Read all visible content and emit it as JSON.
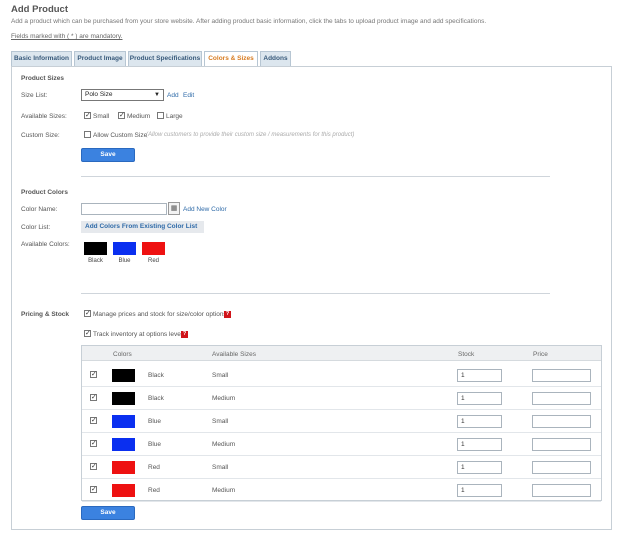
{
  "page": {
    "title": "Add Product",
    "intro": "Add a product which can be purchased from your store website. After adding product basic information, click the tabs to upload product image and add specifications.",
    "mandatory_note": "Fields marked with ( * ) are mandatory."
  },
  "tabs": [
    {
      "label": "Basic Information",
      "active": false
    },
    {
      "label": "Product Image",
      "active": false
    },
    {
      "label": "Product Specifications",
      "active": false
    },
    {
      "label": "Colors & Sizes",
      "active": true
    },
    {
      "label": "Addons",
      "active": false
    }
  ],
  "sizes": {
    "heading": "Product Sizes",
    "size_list_label": "Size List:",
    "size_list_value": "Polo Size",
    "add_link": "Add",
    "edit_link": "Edit",
    "available_label": "Available Sizes:",
    "options": [
      {
        "label": "Small",
        "checked": true
      },
      {
        "label": "Medium",
        "checked": true
      },
      {
        "label": "Large",
        "checked": false
      }
    ],
    "custom_label": "Custom Size:",
    "allow_custom_label": "Allow Custom Size",
    "allow_custom_checked": false,
    "allow_custom_hint": "(Allow customers to provide their custom size / measurements for this product)",
    "save_label": "Save"
  },
  "colors": {
    "heading": "Product Colors",
    "color_name_label": "Color Name:",
    "color_name_value": "",
    "add_new_link": "Add New Color",
    "color_list_label": "Color List:",
    "add_existing_label": "Add Colors From Existing Color List",
    "available_label": "Available Colors:",
    "swatches": [
      {
        "name": "Black",
        "hex": "#000000"
      },
      {
        "name": "Blue",
        "hex": "#0a2ff0"
      },
      {
        "name": "Red",
        "hex": "#ee1111"
      }
    ]
  },
  "pricing": {
    "heading": "Pricing & Stock",
    "manage_label": "Manage prices and stock for size/color options",
    "manage_checked": true,
    "track_label": "Track inventory at options level",
    "track_checked": true,
    "help_glyph": "?",
    "columns": {
      "colors": "Colors",
      "sizes": "Available Sizes",
      "stock": "Stock",
      "price": "Price"
    },
    "rows": [
      {
        "checked": true,
        "color": "Black",
        "hex": "#000000",
        "size": "Small",
        "stock": "1",
        "price": ""
      },
      {
        "checked": true,
        "color": "Black",
        "hex": "#000000",
        "size": "Medium",
        "stock": "1",
        "price": ""
      },
      {
        "checked": true,
        "color": "Blue",
        "hex": "#0a2ff0",
        "size": "Small",
        "stock": "1",
        "price": ""
      },
      {
        "checked": true,
        "color": "Blue",
        "hex": "#0a2ff0",
        "size": "Medium",
        "stock": "1",
        "price": ""
      },
      {
        "checked": true,
        "color": "Red",
        "hex": "#ee1111",
        "size": "Small",
        "stock": "1",
        "price": ""
      },
      {
        "checked": true,
        "color": "Red",
        "hex": "#ee1111",
        "size": "Medium",
        "stock": "1",
        "price": ""
      }
    ],
    "save_label": "Save"
  }
}
